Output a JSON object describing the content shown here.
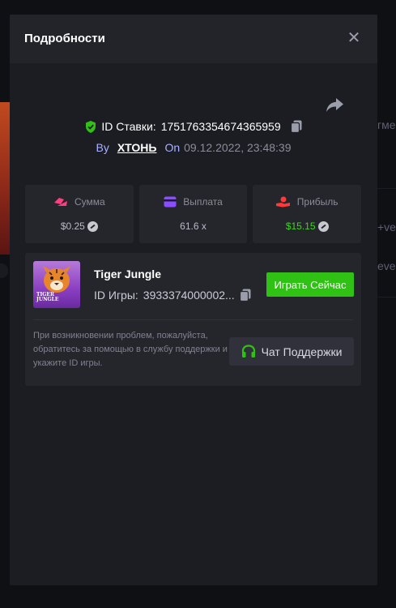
{
  "background": {
    "right_texts": [
      "гмеі",
      "+ve",
      "eve"
    ]
  },
  "modal": {
    "title": "Подробности",
    "close_symbol": "✕"
  },
  "bet": {
    "id_label": "ID Ставки:",
    "id_value": "1751763354674365959",
    "by_label": "By",
    "user": "ХТОНЬ",
    "on_label": "On",
    "date": "09.12.2022, 23:48:39"
  },
  "stats": {
    "amount": {
      "label": "Сумма",
      "value": "$0.25"
    },
    "payout": {
      "label": "Выплата",
      "value": "61.6 x"
    },
    "profit": {
      "label": "Прибыль",
      "value": "$15.15"
    }
  },
  "game": {
    "name": "Tiger Jungle",
    "id_label": "ID Игры:",
    "id_value": "3933374000002...",
    "thumb_text_1": "TIGER",
    "thumb_text_2": "JUNGLE",
    "play_label": "Играть Сейчас",
    "help_text": "При возникновении проблем, пожалуйста, обратитесь за помощью в службу поддержки и укажите ID игры.",
    "support_label": "Чат Поддержки"
  },
  "colors": {
    "accent_green": "#2fc214",
    "profit_green": "#3ed61e",
    "amount_pink": "#ff3d7f",
    "payout_purple": "#8a4dff",
    "profit_red": "#ff3a3a"
  }
}
